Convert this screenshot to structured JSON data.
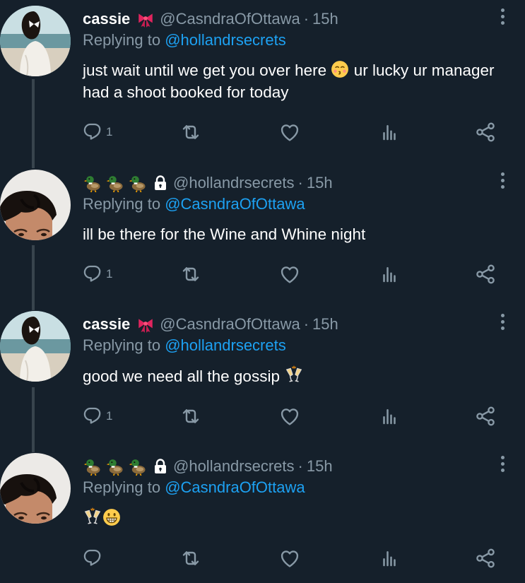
{
  "tweets": [
    {
      "name": "cassie",
      "handle": "@CasndraOfOttawa",
      "separator": "·",
      "time": "15h",
      "replying_prefix": "Replying to",
      "replying_to": "@hollandrsecrets",
      "text_a": "just wait until we get you over here",
      "text_b": "ur lucky ur manager had a shoot booked for today",
      "reply_count": "1",
      "avatar": "beach-girl"
    },
    {
      "name": "",
      "handle": "@hollandrsecrets",
      "separator": "·",
      "time": "15h",
      "replying_prefix": "Replying to",
      "replying_to": "@CasndraOfOttawa",
      "text_a": "ill be there for the Wine and Whine night",
      "reply_count": "1",
      "avatar": "dark-hair-boy"
    },
    {
      "name": "cassie",
      "handle": "@CasndraOfOttawa",
      "separator": "·",
      "time": "15h",
      "replying_prefix": "Replying to",
      "replying_to": "@hollandrsecrets",
      "text_a": "good we need all the gossip",
      "reply_count": "1",
      "avatar": "beach-girl"
    },
    {
      "name": "",
      "handle": "@hollandrsecrets",
      "separator": "·",
      "time": "15h",
      "replying_prefix": "Replying to",
      "replying_to": "@CasndraOfOttawa",
      "reply_count": "",
      "avatar": "dark-hair-boy"
    }
  ],
  "icons": {
    "reply": "reply-icon",
    "retweet": "retweet-icon",
    "like": "heart-icon",
    "analytics": "analytics-icon",
    "share": "share-icon",
    "more": "more-vertical-icon",
    "bow": "ribbon-bow-emoji",
    "duck": "duck-emoji",
    "lock": "locked-account-icon",
    "kiss": "kissing-face-emoji",
    "champagne": "clinking-glasses-emoji",
    "grin": "grinning-face-emoji"
  },
  "colors": {
    "background": "#15202b",
    "muted": "#8899a6",
    "link": "#1da1f2",
    "thread_line": "#38444d"
  }
}
